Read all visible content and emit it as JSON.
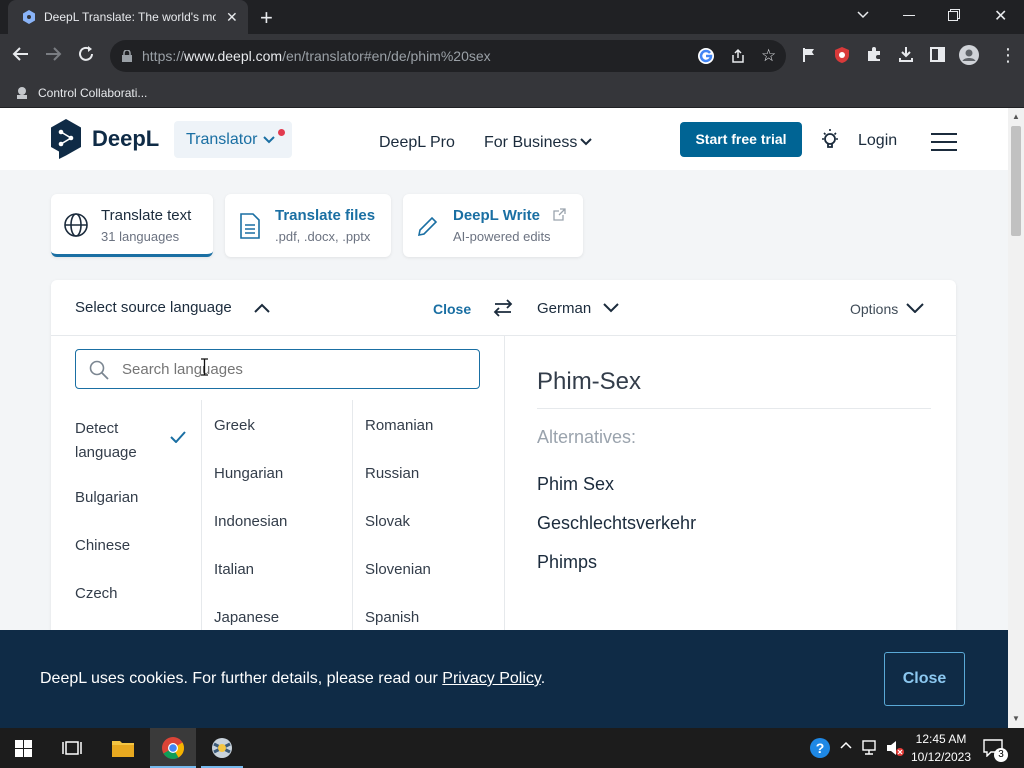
{
  "browser": {
    "tab_title": "DeepL Translate: The world's mo",
    "url_prefix": "https://",
    "url_host": "www.deepl.com",
    "url_path": "/en/translator#en/de/phim%20sex",
    "bookmark_label": "Control Collaborati..."
  },
  "site": {
    "logo_text": "DeepL",
    "translator_label": "Translator",
    "nav": {
      "pro": "DeepL Pro",
      "business": "For Business"
    },
    "trial_button": "Start free trial",
    "login": "Login"
  },
  "mode_tabs": [
    {
      "title": "Translate text",
      "subtitle": "31 languages"
    },
    {
      "title": "Translate files",
      "subtitle": ".pdf, .docx, .pptx"
    },
    {
      "title": "DeepL Write",
      "subtitle": "AI-powered edits"
    }
  ],
  "translator": {
    "source_label": "Select source language",
    "close_label": "Close",
    "target_language": "German",
    "options_label": "Options",
    "search_placeholder": "Search languages",
    "languages_col1": [
      "Detect language",
      "Bulgarian",
      "Chinese",
      "Czech"
    ],
    "languages_col2": [
      "Greek",
      "Hungarian",
      "Indonesian",
      "Italian",
      "Japanese"
    ],
    "languages_col3": [
      "Romanian",
      "Russian",
      "Slovak",
      "Slovenian",
      "Spanish"
    ],
    "translation": "Phim-Sex",
    "alternatives_label": "Alternatives:",
    "alternatives": [
      "Phim Sex",
      "Geschlechtsverkehr",
      "Phimps"
    ]
  },
  "cookie": {
    "text": "DeepL uses cookies. For further details, please read our",
    "link": "Privacy Policy",
    "period": ".",
    "close": "Close"
  },
  "taskbar": {
    "time": "12:45 AM",
    "date": "10/12/2023",
    "notifications": "3"
  },
  "colors": {
    "brand": "#0f2b46",
    "accent": "#006494",
    "link": "#1a6fa3"
  }
}
